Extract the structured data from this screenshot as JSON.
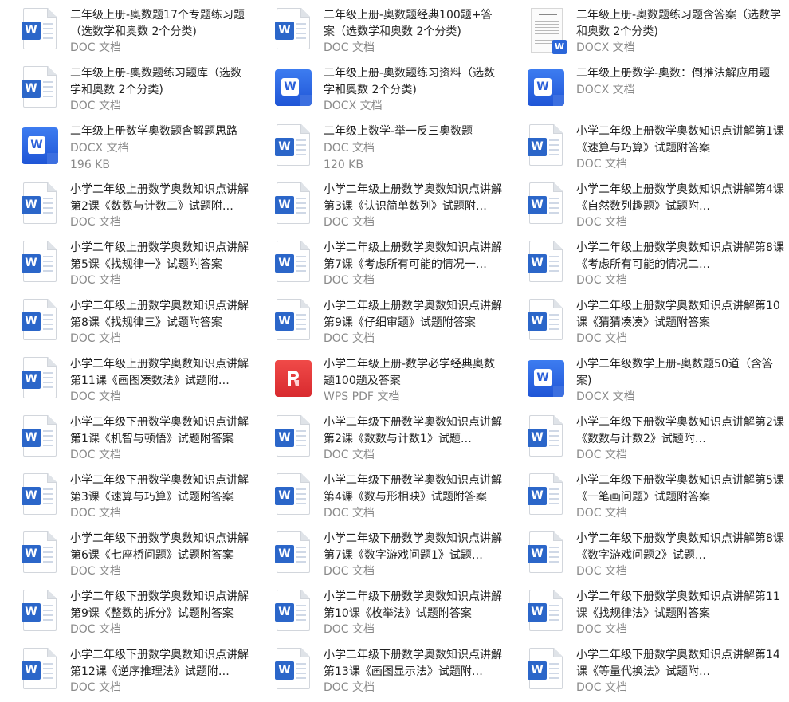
{
  "files": [
    {
      "title": "二年级上册-奥数题17个专题练习题（选数学和奥数 2个分类)",
      "type": "DOC 文档",
      "size": "",
      "icon": "word-doc-icon"
    },
    {
      "title": "二年级上册-奥数题经典100题+答案（选数学和奥数 2个分类)",
      "type": "DOC 文档",
      "size": "",
      "icon": "word-doc-icon"
    },
    {
      "title": "二年级上册-奥数题练习题含答案（选数学和奥数 2个分类)",
      "type": "DOCX 文档",
      "size": "",
      "icon": "docx-thumbnail-icon"
    },
    {
      "title": "二年级上册-奥数题练习题库（选数学和奥数 2个分类)",
      "type": "DOC 文档",
      "size": "",
      "icon": "word-doc-icon"
    },
    {
      "title": "二年级上册-奥数题练习资料（选数学和奥数 2个分类)",
      "type": "DOCX 文档",
      "size": "",
      "icon": "word-docx-icon"
    },
    {
      "title": "二年级上册数学-奥数：倒推法解应用题",
      "type": "DOCX 文档",
      "size": "",
      "icon": "word-docx-icon"
    },
    {
      "title": "二年级上册数学奥数题含解题思路",
      "type": "DOCX 文档",
      "size": "196 KB",
      "icon": "word-docx-icon"
    },
    {
      "title": "二年级上数学-举一反三奥数题",
      "type": "DOC 文档",
      "size": "120 KB",
      "icon": "word-doc-icon"
    },
    {
      "title": "小学二年级上册数学奥数知识点讲解第1课《速算与巧算》试题附答案",
      "type": "DOC 文档",
      "size": "",
      "icon": "word-doc-icon"
    },
    {
      "title": "小学二年级上册数学奥数知识点讲解第2课《数数与计数二》试题附…",
      "type": "DOC 文档",
      "size": "",
      "icon": "word-doc-icon"
    },
    {
      "title": "小学二年级上册数学奥数知识点讲解第3课《认识简单数列》试题附…",
      "type": "DOC 文档",
      "size": "",
      "icon": "word-doc-icon"
    },
    {
      "title": "小学二年级上册数学奥数知识点讲解第4课《自然数列趣题》试题附…",
      "type": "DOC 文档",
      "size": "",
      "icon": "word-doc-icon"
    },
    {
      "title": "小学二年级上册数学奥数知识点讲解第5课《找规律一》试题附答案",
      "type": "DOC 文档",
      "size": "",
      "icon": "word-doc-icon"
    },
    {
      "title": "小学二年级上册数学奥数知识点讲解第7课《考虑所有可能的情况一…",
      "type": "DOC 文档",
      "size": "",
      "icon": "word-doc-icon"
    },
    {
      "title": "小学二年级上册数学奥数知识点讲解第8课《考虑所有可能的情况二…",
      "type": "DOC 文档",
      "size": "",
      "icon": "word-doc-icon"
    },
    {
      "title": "小学二年级上册数学奥数知识点讲解第8课《找规律三》试题附答案",
      "type": "DOC 文档",
      "size": "",
      "icon": "word-doc-icon"
    },
    {
      "title": "小学二年级上册数学奥数知识点讲解第9课《仔细审题》试题附答案",
      "type": "DOC 文档",
      "size": "",
      "icon": "word-doc-icon"
    },
    {
      "title": "小学二年级上册数学奥数知识点讲解第10课《猜猜凑凑》试题附答案",
      "type": "DOC 文档",
      "size": "",
      "icon": "word-doc-icon"
    },
    {
      "title": "小学二年级上册数学奥数知识点讲解第11课《画图凑数法》试题附…",
      "type": "DOC 文档",
      "size": "",
      "icon": "word-doc-icon"
    },
    {
      "title": "小学二年级上册-数学必学经典奥数题100题及答案",
      "type": "WPS PDF 文档",
      "size": "",
      "icon": "wps-pdf-icon"
    },
    {
      "title": "小学二年级数学上册-奥数题50道（含答案)",
      "type": "DOCX 文档",
      "size": "",
      "icon": "word-docx-icon"
    },
    {
      "title": "小学二年级下册数学奥数知识点讲解第1课《机智与顿悟》试题附答案",
      "type": "DOC 文档",
      "size": "",
      "icon": "word-doc-icon"
    },
    {
      "title": "小学二年级下册数学奥数知识点讲解第2课《数数与计数1》试题…",
      "type": "DOC 文档",
      "size": "",
      "icon": "word-doc-icon"
    },
    {
      "title": "小学二年级下册数学奥数知识点讲解第2课《数数与计数2》试题附…",
      "type": "DOC 文档",
      "size": "",
      "icon": "word-doc-icon"
    },
    {
      "title": "小学二年级下册数学奥数知识点讲解第3课《速算与巧算》试题附答案",
      "type": "DOC 文档",
      "size": "",
      "icon": "word-doc-icon"
    },
    {
      "title": "小学二年级下册数学奥数知识点讲解第4课《数与形相映》试题附答案",
      "type": "DOC 文档",
      "size": "",
      "icon": "word-doc-icon"
    },
    {
      "title": "小学二年级下册数学奥数知识点讲解第5课《一笔画问题》试题附答案",
      "type": "DOC 文档",
      "size": "",
      "icon": "word-doc-icon"
    },
    {
      "title": "小学二年级下册数学奥数知识点讲解第6课《七座桥问题》试题附答案",
      "type": "DOC 文档",
      "size": "",
      "icon": "word-doc-icon"
    },
    {
      "title": "小学二年级下册数学奥数知识点讲解第7课《数字游戏问题1》试题…",
      "type": "DOC 文档",
      "size": "",
      "icon": "word-doc-icon"
    },
    {
      "title": "小学二年级下册数学奥数知识点讲解第8课《数字游戏问题2》试题…",
      "type": "DOC 文档",
      "size": "",
      "icon": "word-doc-icon"
    },
    {
      "title": "小学二年级下册数学奥数知识点讲解第9课《整数的拆分》试题附答案",
      "type": "DOC 文档",
      "size": "",
      "icon": "word-doc-icon"
    },
    {
      "title": "小学二年级下册数学奥数知识点讲解第10课《枚举法》试题附答案",
      "type": "DOC 文档",
      "size": "",
      "icon": "word-doc-icon"
    },
    {
      "title": "小学二年级下册数学奥数知识点讲解第11课《找规律法》试题附答案",
      "type": "DOC 文档",
      "size": "",
      "icon": "word-doc-icon"
    },
    {
      "title": "小学二年级下册数学奥数知识点讲解第12课《逆序推理法》试题附…",
      "type": "DOC 文档",
      "size": "",
      "icon": "word-doc-icon"
    },
    {
      "title": "小学二年级下册数学奥数知识点讲解第13课《画图显示法》试题附…",
      "type": "DOC 文档",
      "size": "",
      "icon": "word-doc-icon"
    },
    {
      "title": "小学二年级下册数学奥数知识点讲解第14课《等量代换法》试题附…",
      "type": "DOC 文档",
      "size": "",
      "icon": "word-doc-icon"
    }
  ]
}
